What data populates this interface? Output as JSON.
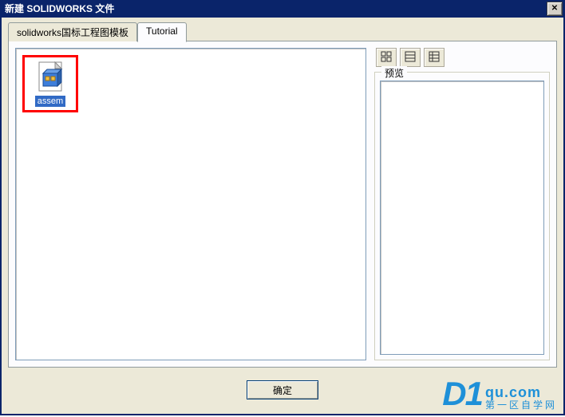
{
  "window": {
    "title": "新建 SOLIDWORKS 文件",
    "close_glyph": "✕"
  },
  "tabs": [
    {
      "label": "solidworks国标工程图模板",
      "active": false
    },
    {
      "label": "Tutorial",
      "active": true
    }
  ],
  "items": [
    {
      "name": "assem",
      "icon": "assembly"
    }
  ],
  "view_buttons": [
    {
      "name": "large-icons"
    },
    {
      "name": "list-view"
    },
    {
      "name": "details-view"
    }
  ],
  "preview": {
    "legend": "预览"
  },
  "buttons": {
    "ok": "确定"
  },
  "watermark": {
    "logo": "D1",
    "domain": "qu.com",
    "subtitle": "第一区自学网"
  }
}
